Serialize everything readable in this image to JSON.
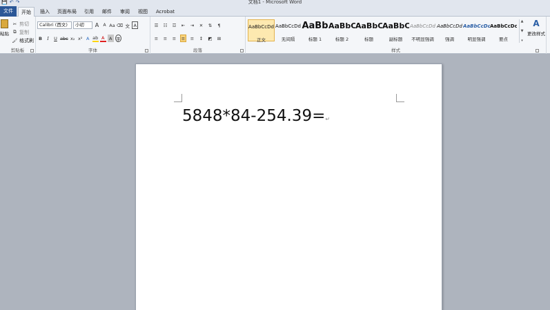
{
  "window": {
    "title": "文档1 - Microsoft Word"
  },
  "qat": {
    "save": "💾",
    "undo": "↶",
    "redo": "↷"
  },
  "tabs": [
    {
      "label": "文件"
    },
    {
      "label": "开始"
    },
    {
      "label": "插入"
    },
    {
      "label": "页面布局"
    },
    {
      "label": "引用"
    },
    {
      "label": "邮件"
    },
    {
      "label": "审阅"
    },
    {
      "label": "视图"
    },
    {
      "label": "Acrobat"
    }
  ],
  "clipboard": {
    "paste": "粘贴",
    "cut": "剪切",
    "copy": "复制",
    "format_painter": "格式刷",
    "label": "剪贴板"
  },
  "font": {
    "family": "Calibri (西文)",
    "size": "小初",
    "label": "字体",
    "grow": "A",
    "shrink": "A",
    "case": "Aa",
    "phonetic": "文",
    "border_char": "A",
    "bold": "B",
    "italic": "I",
    "underline": "U",
    "strike": "abc",
    "sub": "x₂",
    "sup": "x²",
    "effects": "A",
    "highlight": "ab",
    "color": "A",
    "shade_char": "A",
    "enclose": "字"
  },
  "paragraph": {
    "label": "段落"
  },
  "styles": {
    "label": "样式",
    "items": [
      {
        "sample": "AaBbCcDd",
        "name": "正文",
        "active": true
      },
      {
        "sample": "AaBbCcDd",
        "name": "无间隔"
      },
      {
        "sample": "AaBb",
        "name": "标题 1"
      },
      {
        "sample": "AaBbC",
        "name": "标题 2"
      },
      {
        "sample": "AaBbC",
        "name": "标题"
      },
      {
        "sample": "AaBbC",
        "name": "副标题"
      },
      {
        "sample": "AaBbCcDd",
        "name": "不明显强调"
      },
      {
        "sample": "AaBbCcDd",
        "name": "强调"
      },
      {
        "sample": "AaBbCcDc",
        "name": "明显强调"
      },
      {
        "sample": "AaBbCcDc",
        "name": "要点"
      }
    ],
    "change_styles": "更改样式"
  },
  "document": {
    "text": "5848*84-254.39="
  }
}
